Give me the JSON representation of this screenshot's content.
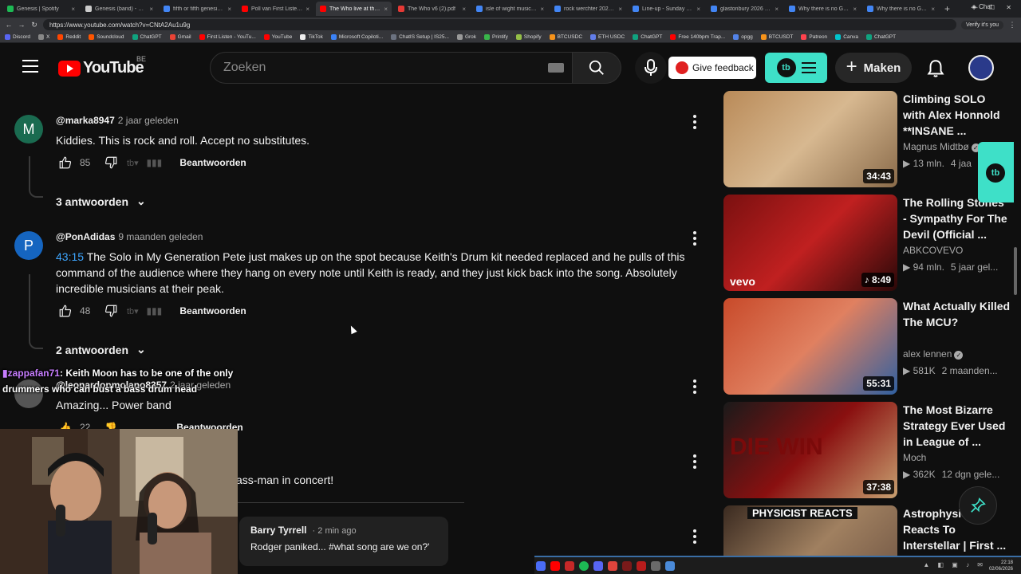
{
  "browser": {
    "tabs": [
      {
        "label": "Genesis | Spotify",
        "color": "#1db954",
        "active": false
      },
      {
        "label": "Genesis (band) - Wikipe",
        "color": "#cccccc",
        "active": false
      },
      {
        "label": "fifth or fifth genesis - Sea",
        "color": "#4285f4",
        "active": false
      },
      {
        "label": "Poll van First Listen - Yo",
        "color": "#ff0000",
        "active": false
      },
      {
        "label": "The Who live at the Isle o",
        "color": "#ff0000",
        "active": true
      },
      {
        "label": "The Who v6 (2).pdf",
        "color": "#e53935",
        "active": false
      },
      {
        "label": "isle of wight music festiv",
        "color": "#4285f4",
        "active": false
      },
      {
        "label": "rock werchter 2026 - Se",
        "color": "#4285f4",
        "active": false
      },
      {
        "label": "Line-up - Sunday - Time",
        "color": "#4285f4",
        "active": false
      },
      {
        "label": "glastonbury 2026 - Sear",
        "color": "#4285f4",
        "active": false
      },
      {
        "label": "Why there is no Glastonb",
        "color": "#4285f4",
        "active": false
      },
      {
        "label": "Why there is no Glasto",
        "color": "#4285f4",
        "active": false
      }
    ],
    "new_tab": "+",
    "chat_label": "Chat",
    "window_controls": "— ☐ ✕",
    "url": "https://www.youtube.com/watch?v=CNtA2Au1u9g",
    "verify_label": "Verify it's you",
    "bookmarks": [
      {
        "label": "Discord",
        "color": "#5865f2"
      },
      {
        "label": "X",
        "color": "#888888"
      },
      {
        "label": "Reddit",
        "color": "#ff4500"
      },
      {
        "label": "Soundcloud",
        "color": "#ff5500"
      },
      {
        "label": "ChatGPT",
        "color": "#10a37f"
      },
      {
        "label": "Gmail",
        "color": "#ea4335"
      },
      {
        "label": "First Listen - YouTu...",
        "color": "#ff0000"
      },
      {
        "label": "YouTube",
        "color": "#ff0000"
      },
      {
        "label": "TikTok",
        "color": "#eeeeee"
      },
      {
        "label": "Microsoft Copiloti...",
        "color": "#3b82f6"
      },
      {
        "label": "ChatIS Setup | IS25...",
        "color": "#6b7280"
      },
      {
        "label": "Grok",
        "color": "#999999"
      },
      {
        "label": "Printify",
        "color": "#39b54a"
      },
      {
        "label": "Shopify",
        "color": "#95bf47"
      },
      {
        "label": "BTCUSDC",
        "color": "#f7931a"
      },
      {
        "label": "ETH USDC",
        "color": "#627eea"
      },
      {
        "label": "ChatGPT",
        "color": "#10a37f"
      },
      {
        "label": "Free 140bpm Trap...",
        "color": "#ff0000"
      },
      {
        "label": "opgg",
        "color": "#5383e8"
      },
      {
        "label": "BTCUSDT",
        "color": "#f7931a"
      },
      {
        "label": "Patreon",
        "color": "#ff424d"
      },
      {
        "label": "Canva",
        "color": "#00c4cc"
      },
      {
        "label": "ChatGPT",
        "color": "#10a37f"
      }
    ]
  },
  "header": {
    "logo_text": "YouTube",
    "country_code": "BE",
    "search_placeholder": "Zoeken",
    "feedback_label": "Give feedback",
    "create_label": "Maken",
    "ext_badge": "tb"
  },
  "comments": [
    {
      "avatar_letter": "M",
      "avatar_color": "#1a6b50",
      "username": "@marka8947",
      "time": "2 jaar geleden",
      "timestamp": "",
      "text": "Kiddies. This is rock and roll. Accept no substitutes.",
      "likes": "85",
      "reply_label": "Beantwoorden",
      "replies_label": "3 antwoorden"
    },
    {
      "avatar_letter": "P",
      "avatar_color": "#1565c0",
      "username": "@PonAdidas",
      "time": "9 maanden geleden",
      "timestamp": "43:15",
      "text": "The Solo in My Generation Pete just makes up on the spot because Keith's Drum kit needed replaced and he pulls of this command of the audience where they hang on every note until Keith is ready, and they just kick back into the song. Absolutely incredible musicians at their peak.",
      "likes": "48",
      "reply_label": "Beantwoorden",
      "replies_label": "2 antwoorden"
    },
    {
      "avatar_letter": "",
      "avatar_color": "#555555",
      "username": "@leonardopmolano8357",
      "time": "2 jaar geleden",
      "timestamp": "",
      "text": "Amazing... Power band",
      "likes": "22",
      "reply_label": "Beantwoorden",
      "replies_label": ""
    },
    {
      "avatar_letter": "",
      "avatar_color": "#555555",
      "username": "",
      "time": "",
      "timestamp": "",
      "text": "ass-man in concert!",
      "likes": "",
      "reply_label": "",
      "replies_label": ""
    }
  ],
  "sidebar": [
    {
      "title": "Climbing SOLO with Alex Honnold **INSANE ...",
      "channel": "Magnus Midtbø",
      "verified": true,
      "views": "13 mln.",
      "age": "4 jaa",
      "duration": "34:43",
      "thumb_colors": [
        "#b98a58",
        "#d7b890",
        "#8a6b4a"
      ],
      "music": false
    },
    {
      "title": "The Rolling Stones - Sympathy For The Devil (Official ...",
      "channel": "ABKCOVEVO",
      "verified": false,
      "views": "94 mln.",
      "age": "5 jaar gel...",
      "duration": "8:49",
      "thumb_colors": [
        "#7a1010",
        "#c02020",
        "#2a0808"
      ],
      "music": true,
      "overlay": "vevo"
    },
    {
      "title": "What Actually Killed The MCU?",
      "channel": "alex lennen",
      "verified": true,
      "views": "581K",
      "age": "2 maanden...",
      "duration": "55:31",
      "thumb_colors": [
        "#c84a2a",
        "#e08060",
        "#3060a0"
      ],
      "music": false
    },
    {
      "title": "The Most Bizarre Strategy Ever Used in League of ...",
      "channel": "Moch",
      "verified": false,
      "views": "362K",
      "age": "12 dgn gele...",
      "duration": "37:38",
      "thumb_colors": [
        "#1a1a1a",
        "#8a1010",
        "#c8a070"
      ],
      "music": false,
      "overlay": "DIE WIN"
    },
    {
      "title": "Astrophysicist Reacts To Interstellar | First ...",
      "channel": "",
      "verified": false,
      "views": "",
      "age": "",
      "duration": "",
      "thumb_colors": [
        "#3a2a20",
        "#a08060",
        "#6a5040"
      ],
      "music": false,
      "overlay": "PHYSICIST REACTS"
    }
  ],
  "stream": {
    "chat_user": "zappafan71",
    "chat_message": "Keith Moon has to be one of the only drummers who can bust a bass drum head",
    "toast_name": "Barry Tyrrell",
    "toast_time": "2 min ago",
    "toast_message": "Rodger paniked... #what song are we on?'"
  },
  "taskbar": {
    "time": "22:18",
    "date": "02/06/2026"
  }
}
